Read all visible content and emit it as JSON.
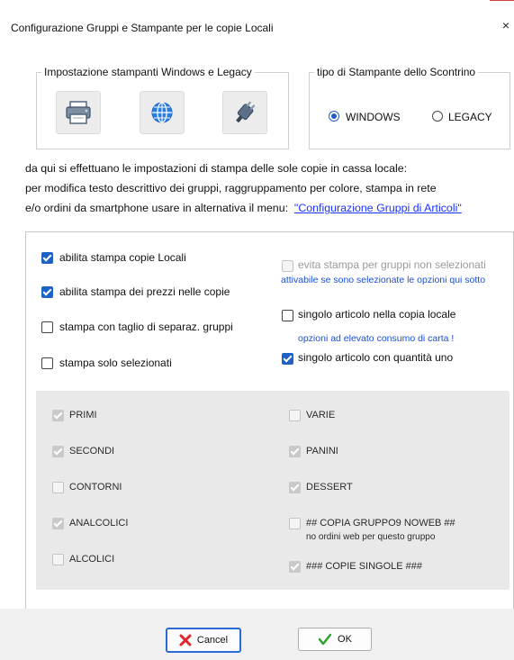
{
  "window": {
    "title": "Configurazione Gruppi e Stampante per le copie Locali",
    "close_glyph": "×"
  },
  "printers_group": {
    "legend": "Impostazione stampanti Windows e Legacy",
    "icons": [
      "printer-icon",
      "globe-icon",
      "plug-icon"
    ]
  },
  "receipt_group": {
    "legend": "tipo di Stampante dello Scontrino",
    "options": [
      {
        "label": "WINDOWS",
        "selected": true
      },
      {
        "label": "LEGACY",
        "selected": false
      }
    ]
  },
  "info": {
    "line1": "da qui si effettuano le impostazioni di stampa delle sole copie in cassa locale:",
    "line2": "per modifica testo descrittivo dei gruppi, raggruppamento per colore, stampa in rete",
    "line3_prefix": "e/o ordini da smartphone usare in alternativa il menu:  ",
    "line3_link": "\"Configurazione Gruppi di Articoli\""
  },
  "options_left": [
    {
      "label": "abilita stampa copie Locali",
      "checked": true
    },
    {
      "label": "abilita stampa dei prezzi nelle copie",
      "checked": true
    },
    {
      "label": "stampa con taglio di separaz. gruppi",
      "checked": false
    },
    {
      "label": "stampa solo selezionati",
      "checked": false
    }
  ],
  "options_right": {
    "evita": {
      "label": "evita stampa per gruppi non selezionati",
      "checked": false,
      "disabled": true
    },
    "evita_note": "attivabile se sono selezionate le opzioni qui sotto",
    "singolo": {
      "label": "singolo articolo nella copia locale",
      "checked": false
    },
    "paper_note": "opzioni ad elevato consumo di carta !",
    "quantita": {
      "label": "singolo articolo con quantità uno",
      "checked": true
    }
  },
  "groups_left": [
    {
      "label": "PRIMI",
      "checked": true
    },
    {
      "label": "SECONDI",
      "checked": true
    },
    {
      "label": "CONTORNI",
      "checked": false
    },
    {
      "label": "ANALCOLICI",
      "checked": true
    },
    {
      "label": "ALCOLICI",
      "checked": false
    }
  ],
  "groups_right": [
    {
      "label": "VARIE",
      "checked": false
    },
    {
      "label": "PANINI",
      "checked": true
    },
    {
      "label": "DESSERT",
      "checked": true
    },
    {
      "label": "## COPIA GRUPPO9 NOWEB ##",
      "checked": false
    },
    {
      "label": "###  COPIE SINGOLE  ###",
      "checked": true
    }
  ],
  "group9_note": "no ordini web per questo gruppo",
  "buttons": {
    "cancel": "Cancel",
    "ok": "OK"
  },
  "colors": {
    "accent": "#1f62c6",
    "link": "#1a33ff",
    "cancel_icon": "#e0242a",
    "ok_icon": "#2aa12a"
  }
}
